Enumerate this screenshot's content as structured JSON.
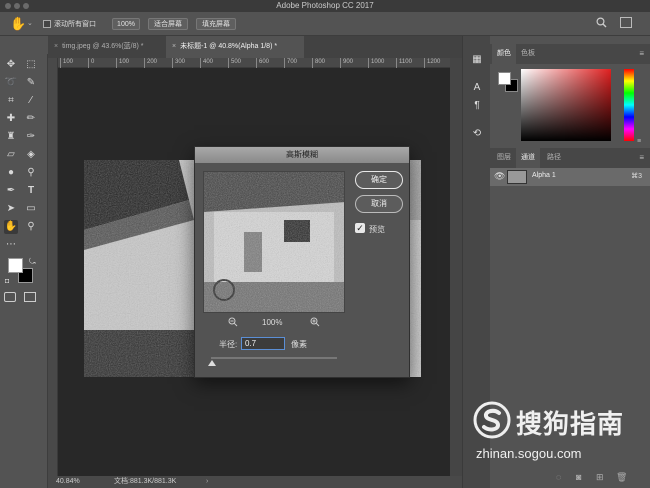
{
  "app": {
    "title": "Adobe Photoshop CC 2017"
  },
  "options_bar": {
    "scroll_all_label": "滚动所有窗口",
    "zoom_100_label": "100%",
    "fit_screen_label": "适合屏幕",
    "fill_screen_label": "填充屏幕"
  },
  "doc_tabs": [
    {
      "label": "timg.jpeg @ 43.6%(蓝/8) *"
    },
    {
      "label": "未标题-1 @ 40.8%(Alpha 1/8) *"
    }
  ],
  "ruler": {
    "ticks": [
      "100",
      "0",
      "100",
      "200",
      "300",
      "400",
      "500",
      "600",
      "700",
      "800",
      "900",
      "1000",
      "1100",
      "1200"
    ]
  },
  "status": {
    "zoom": "40.84%",
    "doc_info": "文档:881.3K/881.3K"
  },
  "panels": {
    "color_tabs": [
      "颜色",
      "色板"
    ],
    "channel_tabs": [
      "图层",
      "通道",
      "路径"
    ],
    "channel_row": {
      "name": "Alpha 1",
      "shortcut": "⌘3"
    }
  },
  "dialog": {
    "title": "高斯模糊",
    "ok_label": "确定",
    "cancel_label": "取消",
    "preview_label": "预览",
    "zoom_level": "100%",
    "radius_label": "半径:",
    "radius_value": "0.7",
    "unit_label": "像素"
  },
  "watermark": {
    "brand": "搜狗指南",
    "url": "zhinan.sogou.com"
  },
  "colors": {
    "chrome": "#535353",
    "canvas": "#282828",
    "accent_blue": "#5b8fd6"
  }
}
